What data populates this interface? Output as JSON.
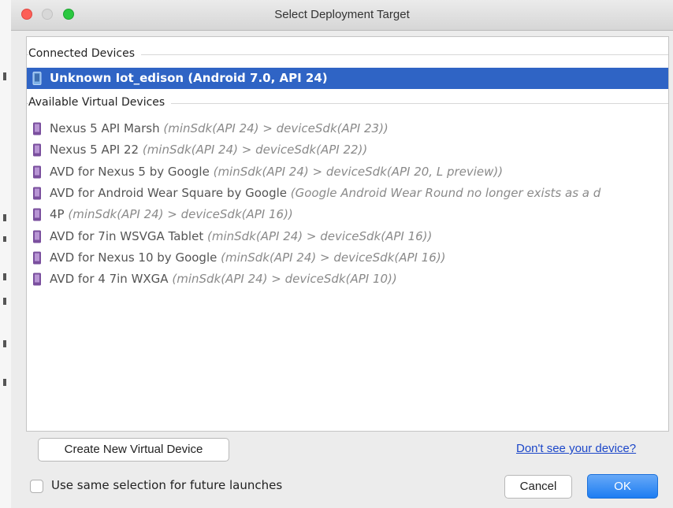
{
  "window": {
    "title": "Select Deployment Target"
  },
  "connected": {
    "header": "Connected Devices",
    "devices": [
      {
        "name": "Unknown Iot_edison (Android 7.0, API 24)",
        "selected": true
      }
    ]
  },
  "virtual": {
    "header": "Available Virtual Devices",
    "devices": [
      {
        "name": "Nexus 5 API Marsh",
        "hint": "(minSdk(API 24) > deviceSdk(API 23))"
      },
      {
        "name": "Nexus 5 API 22",
        "hint": "(minSdk(API 24) > deviceSdk(API 22))"
      },
      {
        "name": "AVD for Nexus 5 by Google",
        "hint": "(minSdk(API 24) > deviceSdk(API 20, L preview))"
      },
      {
        "name": "AVD for Android Wear Square by Google",
        "hint": "(Google Android Wear Round no longer exists as a d"
      },
      {
        "name": "4P",
        "hint": "(minSdk(API 24) > deviceSdk(API 16))"
      },
      {
        "name": "AVD for 7in WSVGA Tablet",
        "hint": "(minSdk(API 24) > deviceSdk(API 16))"
      },
      {
        "name": "AVD for Nexus 10 by Google",
        "hint": "(minSdk(API 24) > deviceSdk(API 16))"
      },
      {
        "name": "AVD for 4 7in WXGA",
        "hint": "(minSdk(API 24) > deviceSdk(API 10))"
      }
    ]
  },
  "actions": {
    "create_label": "Create New Virtual Device",
    "help_link": "Don't see your device?",
    "remember_label": "Use same selection for future launches",
    "remember_checked": false,
    "cancel_label": "Cancel",
    "ok_label": "OK"
  },
  "icons": {
    "connected_device": "phone-icon",
    "virtual_device": "phone-icon"
  },
  "colors": {
    "selection": "#2f64c5",
    "ok_button": "#1d7df2",
    "link": "#1c47c9",
    "virtual_icon": "#7a4f9e",
    "connected_icon": "#7fb2e8"
  }
}
